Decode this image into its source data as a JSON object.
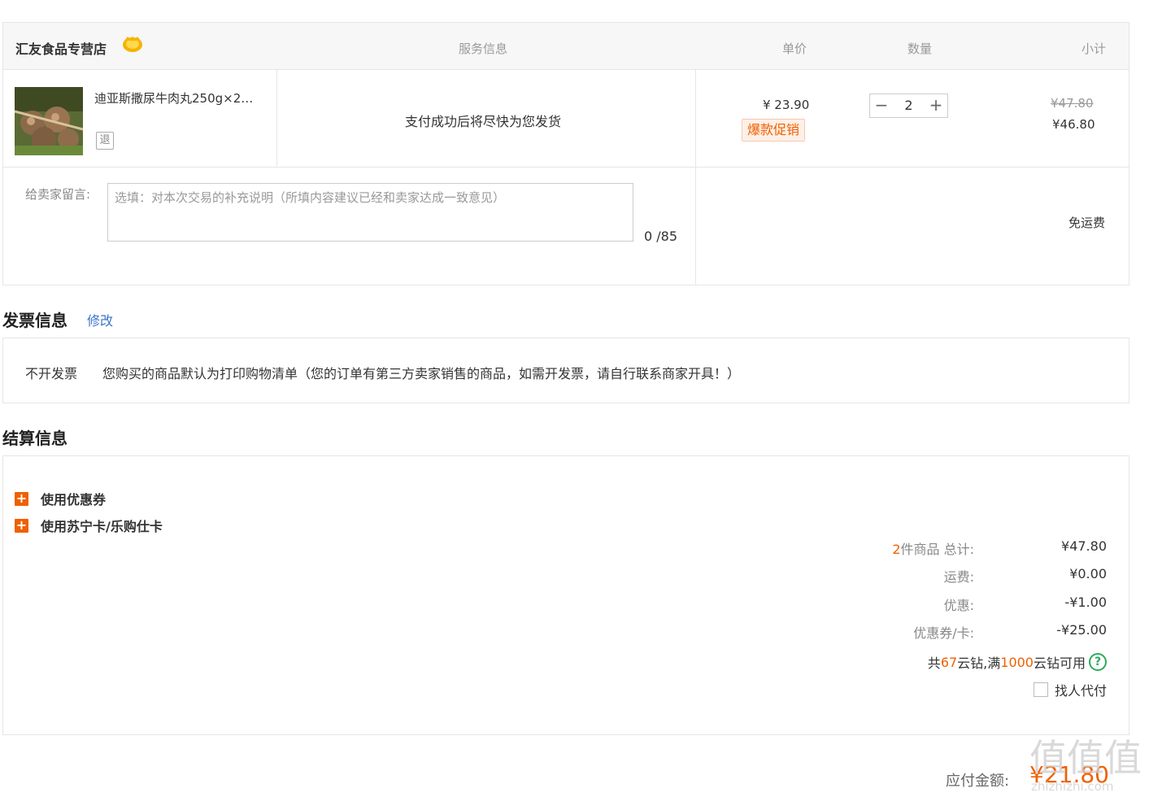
{
  "order": {
    "shop_name": "汇友食品专营店",
    "headers": {
      "service": "服务信息",
      "unit_price": "单价",
      "quantity": "数量",
      "subtotal": "小计"
    },
    "item": {
      "title": "迪亚斯撒尿牛肉丸250g×2…",
      "refund_icon": "退",
      "service_note": "支付成功后将尽快为您发货",
      "unit_price": "¥ 23.90",
      "promo_tag": "爆款促销",
      "qty_minus": "−",
      "qty_plus": "+",
      "quantity": "2",
      "price_original": "¥47.80",
      "price_final": "¥46.80"
    },
    "message": {
      "label": "给卖家留言:",
      "placeholder": "选填：对本次交易的补充说明（所填内容建议已经和卖家达成一致意见）",
      "count": "0 /85"
    },
    "shipping": "免运费"
  },
  "invoice": {
    "title": "发票信息",
    "edit_label": "修改",
    "type": "不开发票",
    "description": "您购买的商品默认为打印购物清单（您的订单有第三方卖家销售的商品，如需开发票，请自行联系商家开具！）"
  },
  "settlement": {
    "title": "结算信息",
    "use_coupon": "使用优惠券",
    "use_card": "使用苏宁卡/乐购仕卡",
    "summary": {
      "item_count": "2",
      "total_label_suffix": "件商品 总计:",
      "total": "¥47.80",
      "freight_label": "运费:",
      "freight": "¥0.00",
      "discount_label": "优惠:",
      "discount": "-¥1.00",
      "coupon_label": "优惠券/卡:",
      "coupon": "-¥25.00"
    },
    "cloud_diamond": {
      "prefix": "共",
      "amount": "67",
      "mid": "云钻,满",
      "threshold": "1000",
      "suffix": "云钻可用"
    },
    "proxy_pay_label": "找人代付"
  },
  "payable": {
    "label": "应付金额:",
    "amount": "¥21.80"
  },
  "watermark": "值值值",
  "watermark_sub": "zhizhizhi.com",
  "colors": {
    "accent": "#f06000",
    "link": "#3b73c9",
    "help": "#2bab5c"
  }
}
